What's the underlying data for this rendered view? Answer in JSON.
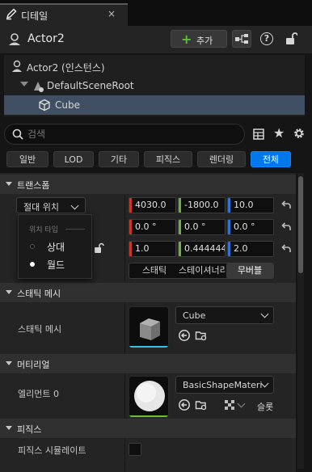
{
  "tab": {
    "title": "디테일",
    "close": "×"
  },
  "header": {
    "actor_name": "Actor2",
    "add_label": "추가"
  },
  "tree": {
    "items": [
      {
        "label": "Actor2 (인스턴스)"
      },
      {
        "label": "DefaultSceneRoot"
      },
      {
        "label": "Cube"
      }
    ]
  },
  "search": {
    "placeholder": "검색"
  },
  "filters": [
    {
      "label": "일반"
    },
    {
      "label": "LOD"
    },
    {
      "label": "기타"
    },
    {
      "label": "피직스"
    },
    {
      "label": "렌더링"
    },
    {
      "label": "전체"
    }
  ],
  "transform": {
    "section_title": "트랜스폼",
    "location_mode": "절대 위치",
    "location": [
      "4030.0",
      "-1800.0",
      "10.0"
    ],
    "rotation": [
      "0.0 °",
      "0.0 °",
      "0.0 °"
    ],
    "scale": [
      "1.0",
      "0.444444",
      "2.0"
    ],
    "mobility": [
      "스태틱",
      "스테이셔너리",
      "무버블"
    ],
    "mobility_selected": "무버블"
  },
  "location_dropdown": {
    "header": "위치 타입",
    "options": [
      "상대",
      "월드"
    ]
  },
  "static_mesh": {
    "section_title": "스태틱 메시",
    "label": "스태틱 메시",
    "value": "Cube"
  },
  "materials": {
    "section_title": "머티리얼",
    "label": "엘리먼트 0",
    "value": "BasicShapeMaterial",
    "slot_label": "슬롯"
  },
  "physics": {
    "section_title": "피직스",
    "simulate_label": "피직스 시뮬레이트"
  },
  "colors": {
    "accent": "#0077ea",
    "x_axis": "#c8352d",
    "y_axis": "#6bb33a",
    "z_axis": "#2f73d8",
    "selection": "#414f63",
    "mesh_underline": "#38c0e0",
    "material_underline": "#67c12a"
  }
}
